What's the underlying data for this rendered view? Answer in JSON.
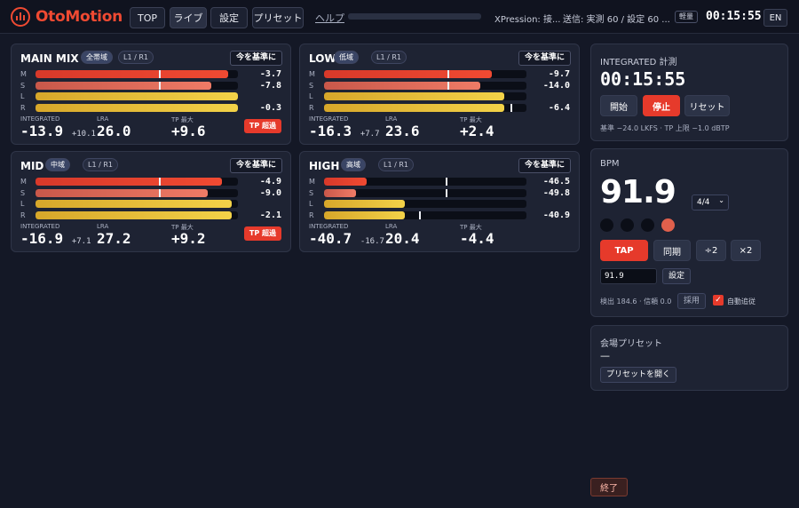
{
  "app": {
    "name": "OtoMotion"
  },
  "nav": [
    {
      "label": "TOP",
      "active": false
    },
    {
      "label": "ライブ",
      "active": true
    },
    {
      "label": "設定",
      "active": false
    },
    {
      "label": "プリセット",
      "active": false
    }
  ],
  "help_label": "ヘルプ",
  "status": {
    "xpression": "XPression: 接...",
    "send": "送信: 実測 60 / 設定 60 ...",
    "mode_badge": "軽量",
    "clock": "00:15:55",
    "lang": "EN"
  },
  "meters": [
    {
      "title": "MAIN MIX",
      "band": "全帯域",
      "channels": "L1 / R1",
      "ref_button": "今を基準に",
      "rows": [
        {
          "label": "M",
          "value": "-3.7",
          "level": 0.95,
          "color": "red",
          "marker": 0.61
        },
        {
          "label": "S",
          "value": "-7.8",
          "level": 0.87,
          "color": "salmon",
          "marker": 0.61
        },
        {
          "label": "L",
          "value": "",
          "level": 1.0,
          "color": "yellow"
        },
        {
          "label": "R",
          "value": "-0.3",
          "level": 1.0,
          "color": "yellow"
        }
      ],
      "integrated_label": "INTEGRATED",
      "integrated": "-13.9",
      "integrated_sub": "+10.1",
      "lra_label": "LRA",
      "lra": "26.0",
      "tp_label": "TP 最大",
      "tp": "+9.6",
      "tp_over": "TP 超過"
    },
    {
      "title": "LOW",
      "band": "低域",
      "channels": "L1 / R1",
      "ref_button": "今を基準に",
      "rows": [
        {
          "label": "M",
          "value": "-9.7",
          "level": 0.83,
          "color": "red",
          "marker": 0.61
        },
        {
          "label": "S",
          "value": "-14.0",
          "level": 0.77,
          "color": "salmon",
          "marker": 0.61
        },
        {
          "label": "L",
          "value": "",
          "level": 0.89,
          "color": "yellow"
        },
        {
          "label": "R",
          "value": "-6.4",
          "level": 0.89,
          "color": "yellow",
          "marker": 0.92
        }
      ],
      "integrated_label": "INTEGRATED",
      "integrated": "-16.3",
      "integrated_sub": "+7.7",
      "lra_label": "LRA",
      "lra": "23.6",
      "tp_label": "TP 最大",
      "tp": "+2.4",
      "tp_over": ""
    },
    {
      "title": "MID",
      "band": "中域",
      "channels": "L1 / R1",
      "ref_button": "今を基準に",
      "rows": [
        {
          "label": "M",
          "value": "-4.9",
          "level": 0.92,
          "color": "red",
          "marker": 0.61
        },
        {
          "label": "S",
          "value": "-9.0",
          "level": 0.85,
          "color": "salmon",
          "marker": 0.61
        },
        {
          "label": "L",
          "value": "",
          "level": 0.97,
          "color": "yellow"
        },
        {
          "label": "R",
          "value": "-2.1",
          "level": 0.97,
          "color": "yellow"
        }
      ],
      "integrated_label": "INTEGRATED",
      "integrated": "-16.9",
      "integrated_sub": "+7.1",
      "lra_label": "LRA",
      "lra": "27.2",
      "tp_label": "TP 最大",
      "tp": "+9.2",
      "tp_over": "TP 超過"
    },
    {
      "title": "HIGH",
      "band": "高域",
      "channels": "L1 / R1",
      "ref_button": "今を基準に",
      "rows": [
        {
          "label": "M",
          "value": "-46.5",
          "level": 0.21,
          "color": "red",
          "marker": 0.6
        },
        {
          "label": "S",
          "value": "-49.8",
          "level": 0.16,
          "color": "salmon",
          "marker": 0.6
        },
        {
          "label": "L",
          "value": "",
          "level": 0.4,
          "color": "yellow"
        },
        {
          "label": "R",
          "value": "-40.9",
          "level": 0.4,
          "color": "yellow",
          "marker": 0.47
        }
      ],
      "integrated_label": "INTEGRATED",
      "integrated": "-40.7",
      "integrated_sub": "-16.7",
      "lra_label": "LRA",
      "lra": "20.4",
      "tp_label": "TP 最大",
      "tp": "-4.4",
      "tp_over": ""
    }
  ],
  "integrated_panel": {
    "title": "INTEGRATED 計測",
    "time": "00:15:55",
    "start": "開始",
    "stop": "停止",
    "reset": "リセット",
    "ref_text": "基準 −24.0 LKFS · TP 上限 −1.0 dBTP"
  },
  "bpm_panel": {
    "title": "BPM",
    "value": "91.9",
    "meter": "4/4",
    "beats": [
      false,
      false,
      false,
      true
    ],
    "tap": "TAP",
    "sync": "同期",
    "half": "÷2",
    "double": "×2",
    "input": "91.9",
    "set": "設定",
    "detect": "検出 184.6 · 信頼 0.0",
    "adopt": "採用",
    "auto_follow": "自動追従",
    "auto_follow_checked": true
  },
  "preset_panel": {
    "title": "会場プリセット",
    "current": "—",
    "open": "プリセットを開く"
  },
  "quit_label": "終了"
}
